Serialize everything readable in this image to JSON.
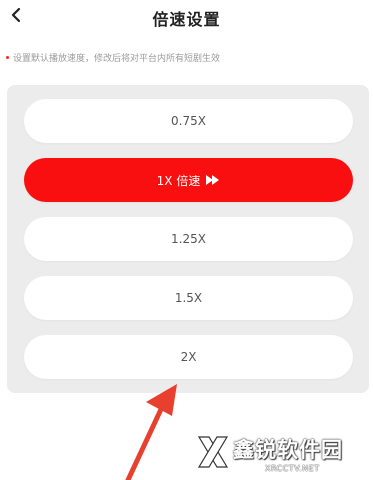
{
  "header": {
    "title": "倍速设置",
    "back_icon": "chevron-left-icon"
  },
  "hint": {
    "text": "设置默认播放速度，修改后将对平台内所有短剧生效",
    "bullet_color": "#ff2a1a"
  },
  "speed_options": [
    {
      "label": "0.75X",
      "selected": false
    },
    {
      "label": "1X 倍速",
      "selected": true,
      "icon": "fast-forward-icon"
    },
    {
      "label": "1.25X",
      "selected": false
    },
    {
      "label": "1.5X",
      "selected": false
    },
    {
      "label": "2X",
      "selected": false
    }
  ],
  "colors": {
    "accent": "#f90f0f",
    "panel_bg": "#ececec",
    "option_bg": "#ffffff",
    "annotation_arrow": "#e8402f"
  },
  "watermark": {
    "title": "鑫锐软件园",
    "subtitle": "XRCCTV.NET"
  }
}
